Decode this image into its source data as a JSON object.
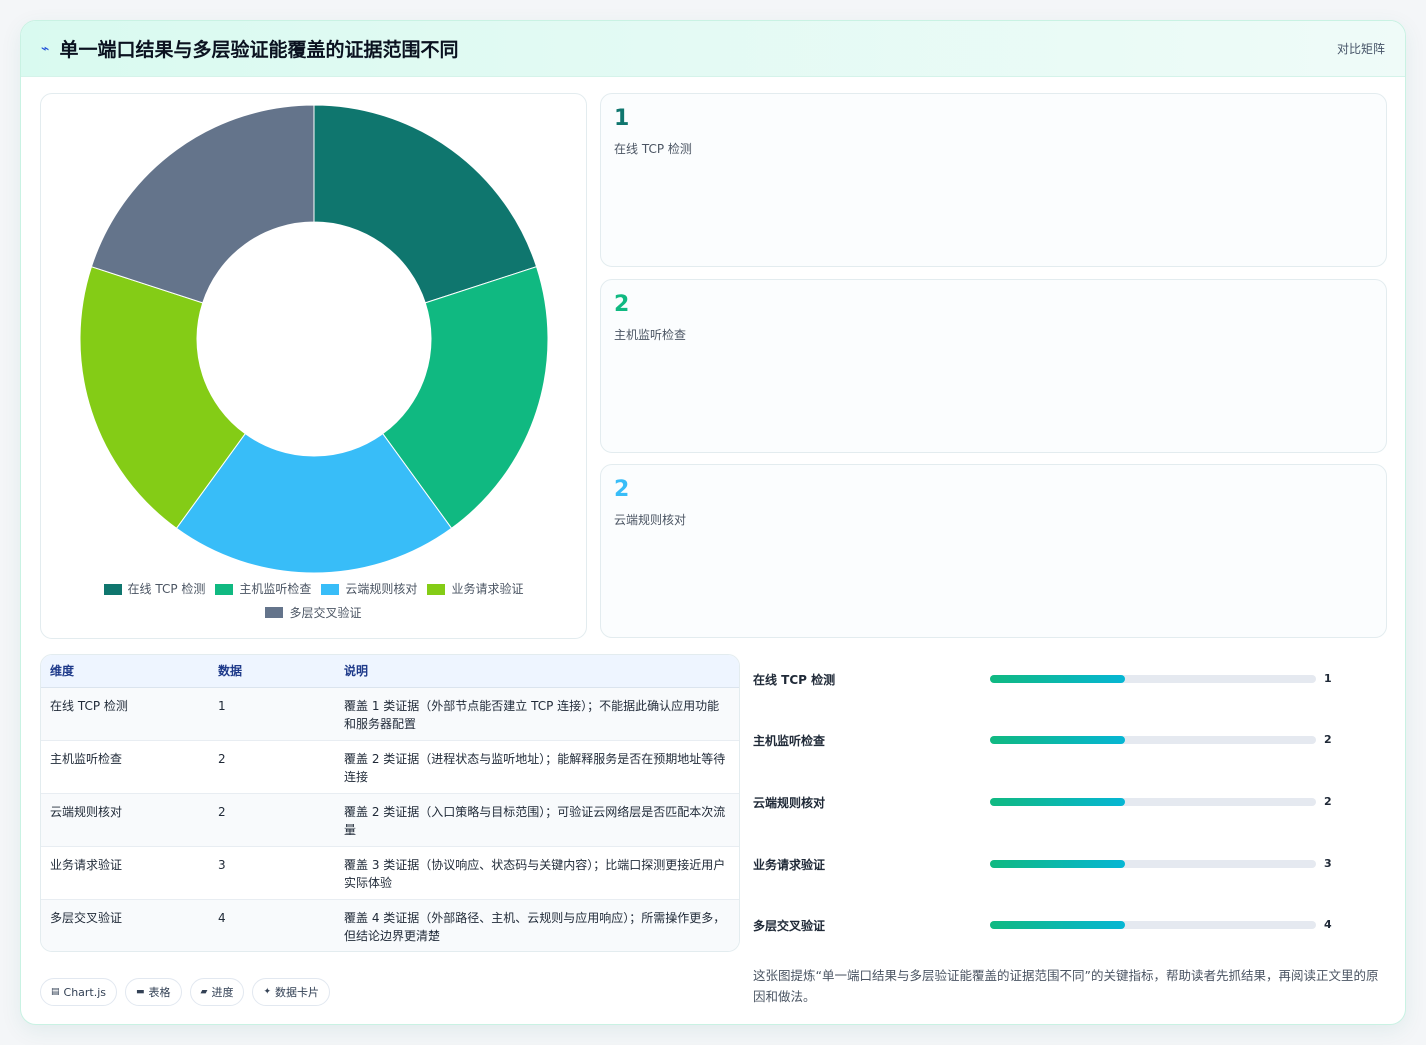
{
  "header": {
    "icon": "lightning-icon",
    "title": "单一端口结果与多层验证能覆盖的证据范围不同",
    "tag": "对比矩阵"
  },
  "chart_data": {
    "type": "pie",
    "donut": true,
    "categories": [
      "在线 TCP 检测",
      "主机监听检查",
      "云端规则核对",
      "业务请求验证",
      "多层交叉验证"
    ],
    "values": [
      1,
      1,
      1,
      1,
      1
    ],
    "colors": [
      "#0f766e",
      "#10b981",
      "#38bdf8",
      "#84cc16",
      "#64748b"
    ],
    "legend_position": "bottom"
  },
  "stats": [
    {
      "value": "1",
      "label": "在线 TCP 检测",
      "color": "#0f766e"
    },
    {
      "value": "2",
      "label": "主机监听检查",
      "color": "#10b981"
    },
    {
      "value": "2",
      "label": "云端规则核对",
      "color": "#38bdf8"
    }
  ],
  "table": {
    "headers": [
      "维度",
      "数据",
      "说明"
    ],
    "rows": [
      {
        "dim": "在线 TCP 检测",
        "val": "1",
        "desc": "覆盖 1 类证据（外部节点能否建立 TCP 连接）；不能据此确认应用功能和服务器配置"
      },
      {
        "dim": "主机监听检查",
        "val": "2",
        "desc": "覆盖 2 类证据（进程状态与监听地址）；能解释服务是否在预期地址等待连接"
      },
      {
        "dim": "云端规则核对",
        "val": "2",
        "desc": "覆盖 2 类证据（入口策略与目标范围）；可验证云网络层是否匹配本次流量"
      },
      {
        "dim": "业务请求验证",
        "val": "3",
        "desc": "覆盖 3 类证据（协议响应、状态码与关键内容）；比端口探测更接近用户实际体验"
      },
      {
        "dim": "多层交叉验证",
        "val": "4",
        "desc": "覆盖 4 类证据（外部路径、主机、云规则与应用响应）；所需操作更多，但结论边界更清楚"
      }
    ]
  },
  "progress": [
    {
      "label": "在线 TCP 检测",
      "value": "1",
      "fill": 0.415
    },
    {
      "label": "主机监听检查",
      "value": "2",
      "fill": 0.415
    },
    {
      "label": "云端规则核对",
      "value": "2",
      "fill": 0.415
    },
    {
      "label": "业务请求验证",
      "value": "3",
      "fill": 0.415
    },
    {
      "label": "多层交叉验证",
      "value": "4",
      "fill": 0.415
    }
  ],
  "caption": "这张图提炼“单一端口结果与多层验证能覆盖的证据范围不同”的关键指标，帮助读者先抓结果，再阅读正文里的原因和做法。",
  "chips": [
    {
      "icon": "chart-icon",
      "glyph": "▤",
      "label": "Chart.js"
    },
    {
      "icon": "table-icon",
      "glyph": "▬",
      "label": "表格"
    },
    {
      "icon": "progress-icon",
      "glyph": "▰",
      "label": "进度"
    },
    {
      "icon": "sparkle-icon",
      "glyph": "✦",
      "label": "数据卡片"
    }
  ]
}
